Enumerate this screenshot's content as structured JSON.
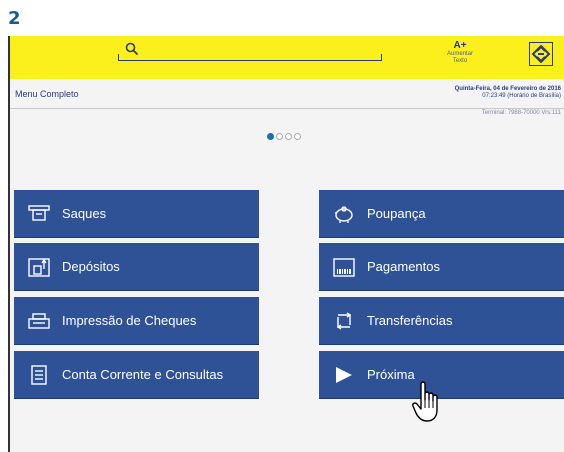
{
  "step": "2",
  "header": {
    "font_size_label": "A+",
    "font_size_sub1": "Aumentar",
    "font_size_sub2": "Texto"
  },
  "menu_title": "Menu Completo",
  "date": {
    "line1": "Quinta-Feira, 04 de Fevereiro de 2016",
    "line2": "07:23:49 (Horário de Brasília)"
  },
  "terminal": "Terminal: 7988-70000 Vrs:111",
  "pager": {
    "count": 4,
    "active": 0
  },
  "buttons": [
    {
      "label": "Saques",
      "icon": "cash-withdrawal-icon"
    },
    {
      "label": "Poupança",
      "icon": "piggy-bank-icon"
    },
    {
      "label": "Depósitos",
      "icon": "deposit-icon"
    },
    {
      "label": "Pagamentos",
      "icon": "barcode-icon"
    },
    {
      "label": "Impressão de Cheques",
      "icon": "check-print-icon"
    },
    {
      "label": "Transferências",
      "icon": "transfer-icon"
    },
    {
      "label": "Conta Corrente e Consultas",
      "icon": "document-icon"
    },
    {
      "label": "Próxima",
      "icon": "play-icon"
    }
  ],
  "colors": {
    "header": "#fbf01c",
    "button": "#2f5196",
    "brand_blue": "#2a3a80",
    "accent": "#1b6fae"
  }
}
